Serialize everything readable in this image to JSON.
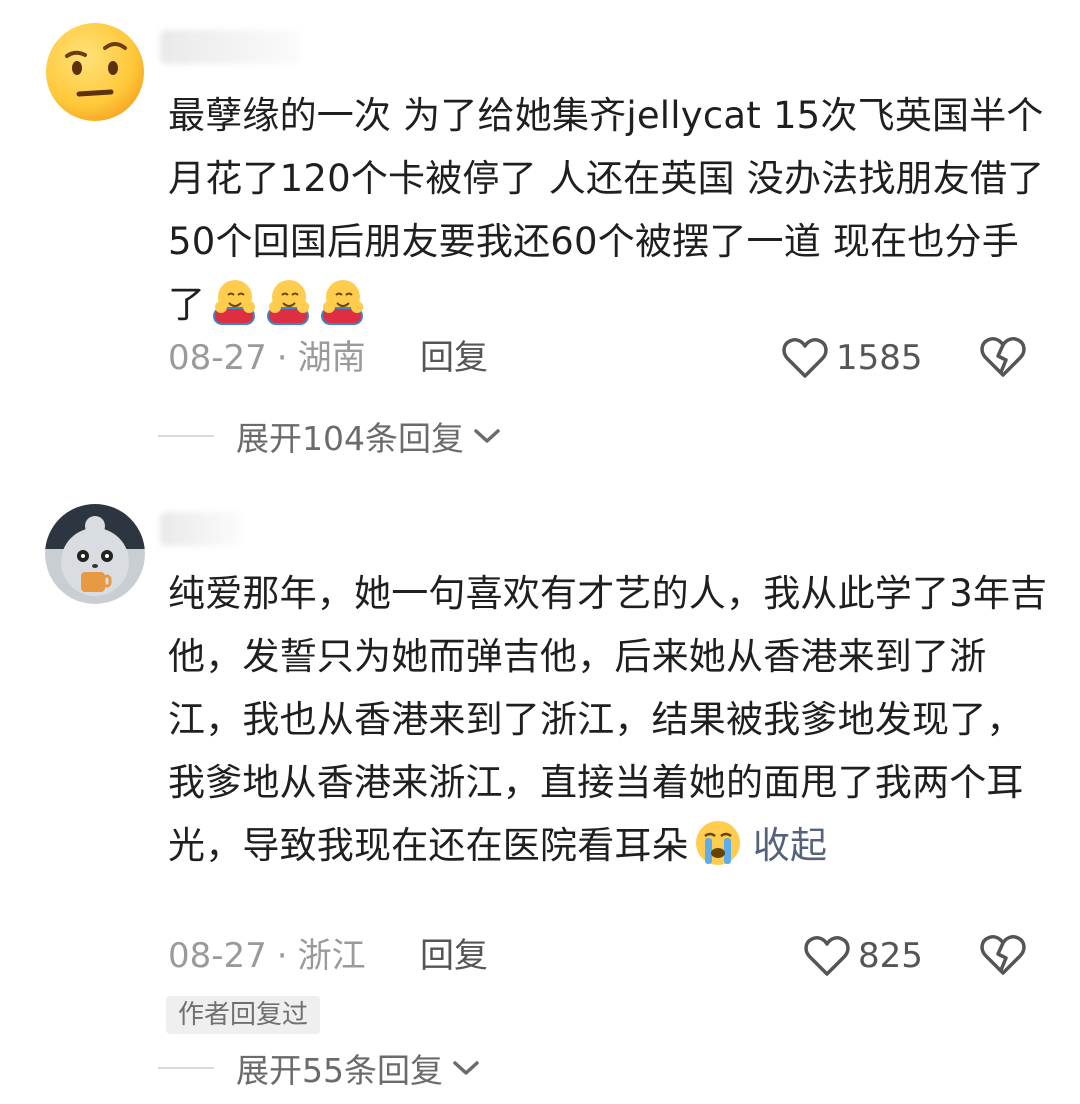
{
  "comments": [
    {
      "text": "最孽缘的一次 为了给她集齐jellycat 15次飞英国半个月花了120个卡被停了 人还在英国 没办法找朋友借了50个回国后朋友要我还60个被摆了一道 现在也分手了",
      "trailing_emojis": [
        "hugging-face-emoji",
        "hugging-face-emoji",
        "hugging-face-emoji"
      ],
      "date": "08-27",
      "separator": "·",
      "location": "湖南",
      "reply_label": "回复",
      "likes": "1585",
      "expand_label": "展开104条回复"
    },
    {
      "text": "纯爱那年，她一句喜欢有才艺的人，我从此学了3年吉他，发誓只为她而弹吉他，后来她从香港来到了浙江，我也从香港来到了浙江，结果被我爹地发现了，我爹地从香港来浙江，直接当着她的面甩了我两个耳光，导致我现在还在医院看耳朵",
      "trailing_emojis": [
        "crying-face-emoji"
      ],
      "collapse_label": "收起",
      "date": "08-27",
      "separator": "·",
      "location": "浙江",
      "reply_label": "回复",
      "likes": "825",
      "author_badge": "作者回复过",
      "expand_label": "展开55条回复"
    }
  ],
  "colors": {
    "meta_gray": "#9a9a9a",
    "link_blue_gray": "#55627a",
    "badge_bg": "#efefef"
  }
}
